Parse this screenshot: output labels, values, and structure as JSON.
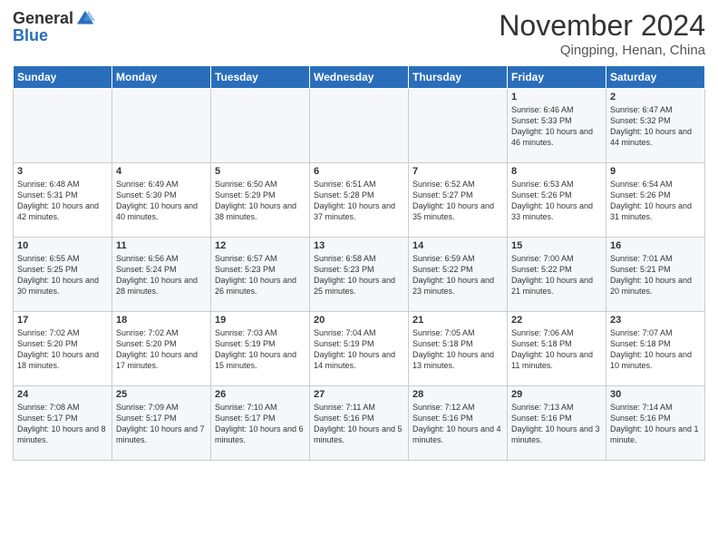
{
  "header": {
    "logo_general": "General",
    "logo_blue": "Blue",
    "month": "November 2024",
    "location": "Qingping, Henan, China"
  },
  "weekdays": [
    "Sunday",
    "Monday",
    "Tuesday",
    "Wednesday",
    "Thursday",
    "Friday",
    "Saturday"
  ],
  "weeks": [
    [
      {
        "day": "",
        "info": ""
      },
      {
        "day": "",
        "info": ""
      },
      {
        "day": "",
        "info": ""
      },
      {
        "day": "",
        "info": ""
      },
      {
        "day": "",
        "info": ""
      },
      {
        "day": "1",
        "info": "Sunrise: 6:46 AM\nSunset: 5:33 PM\nDaylight: 10 hours and 46 minutes."
      },
      {
        "day": "2",
        "info": "Sunrise: 6:47 AM\nSunset: 5:32 PM\nDaylight: 10 hours and 44 minutes."
      }
    ],
    [
      {
        "day": "3",
        "info": "Sunrise: 6:48 AM\nSunset: 5:31 PM\nDaylight: 10 hours and 42 minutes."
      },
      {
        "day": "4",
        "info": "Sunrise: 6:49 AM\nSunset: 5:30 PM\nDaylight: 10 hours and 40 minutes."
      },
      {
        "day": "5",
        "info": "Sunrise: 6:50 AM\nSunset: 5:29 PM\nDaylight: 10 hours and 38 minutes."
      },
      {
        "day": "6",
        "info": "Sunrise: 6:51 AM\nSunset: 5:28 PM\nDaylight: 10 hours and 37 minutes."
      },
      {
        "day": "7",
        "info": "Sunrise: 6:52 AM\nSunset: 5:27 PM\nDaylight: 10 hours and 35 minutes."
      },
      {
        "day": "8",
        "info": "Sunrise: 6:53 AM\nSunset: 5:26 PM\nDaylight: 10 hours and 33 minutes."
      },
      {
        "day": "9",
        "info": "Sunrise: 6:54 AM\nSunset: 5:26 PM\nDaylight: 10 hours and 31 minutes."
      }
    ],
    [
      {
        "day": "10",
        "info": "Sunrise: 6:55 AM\nSunset: 5:25 PM\nDaylight: 10 hours and 30 minutes."
      },
      {
        "day": "11",
        "info": "Sunrise: 6:56 AM\nSunset: 5:24 PM\nDaylight: 10 hours and 28 minutes."
      },
      {
        "day": "12",
        "info": "Sunrise: 6:57 AM\nSunset: 5:23 PM\nDaylight: 10 hours and 26 minutes."
      },
      {
        "day": "13",
        "info": "Sunrise: 6:58 AM\nSunset: 5:23 PM\nDaylight: 10 hours and 25 minutes."
      },
      {
        "day": "14",
        "info": "Sunrise: 6:59 AM\nSunset: 5:22 PM\nDaylight: 10 hours and 23 minutes."
      },
      {
        "day": "15",
        "info": "Sunrise: 7:00 AM\nSunset: 5:22 PM\nDaylight: 10 hours and 21 minutes."
      },
      {
        "day": "16",
        "info": "Sunrise: 7:01 AM\nSunset: 5:21 PM\nDaylight: 10 hours and 20 minutes."
      }
    ],
    [
      {
        "day": "17",
        "info": "Sunrise: 7:02 AM\nSunset: 5:20 PM\nDaylight: 10 hours and 18 minutes."
      },
      {
        "day": "18",
        "info": "Sunrise: 7:02 AM\nSunset: 5:20 PM\nDaylight: 10 hours and 17 minutes."
      },
      {
        "day": "19",
        "info": "Sunrise: 7:03 AM\nSunset: 5:19 PM\nDaylight: 10 hours and 15 minutes."
      },
      {
        "day": "20",
        "info": "Sunrise: 7:04 AM\nSunset: 5:19 PM\nDaylight: 10 hours and 14 minutes."
      },
      {
        "day": "21",
        "info": "Sunrise: 7:05 AM\nSunset: 5:18 PM\nDaylight: 10 hours and 13 minutes."
      },
      {
        "day": "22",
        "info": "Sunrise: 7:06 AM\nSunset: 5:18 PM\nDaylight: 10 hours and 11 minutes."
      },
      {
        "day": "23",
        "info": "Sunrise: 7:07 AM\nSunset: 5:18 PM\nDaylight: 10 hours and 10 minutes."
      }
    ],
    [
      {
        "day": "24",
        "info": "Sunrise: 7:08 AM\nSunset: 5:17 PM\nDaylight: 10 hours and 8 minutes."
      },
      {
        "day": "25",
        "info": "Sunrise: 7:09 AM\nSunset: 5:17 PM\nDaylight: 10 hours and 7 minutes."
      },
      {
        "day": "26",
        "info": "Sunrise: 7:10 AM\nSunset: 5:17 PM\nDaylight: 10 hours and 6 minutes."
      },
      {
        "day": "27",
        "info": "Sunrise: 7:11 AM\nSunset: 5:16 PM\nDaylight: 10 hours and 5 minutes."
      },
      {
        "day": "28",
        "info": "Sunrise: 7:12 AM\nSunset: 5:16 PM\nDaylight: 10 hours and 4 minutes."
      },
      {
        "day": "29",
        "info": "Sunrise: 7:13 AM\nSunset: 5:16 PM\nDaylight: 10 hours and 3 minutes."
      },
      {
        "day": "30",
        "info": "Sunrise: 7:14 AM\nSunset: 5:16 PM\nDaylight: 10 hours and 1 minute."
      }
    ]
  ]
}
